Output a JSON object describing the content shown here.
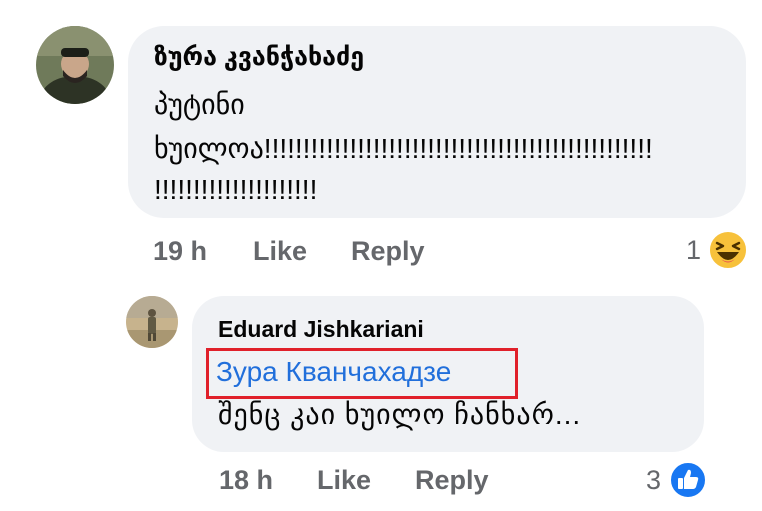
{
  "comment": {
    "author": "ზურა კვანჭახაძე",
    "lines": [
      "პუტინი",
      "ხუილოა!!!!!!!!!!!!!!!!!!!!!!!!!!!!!!!!!!!!!!!!!!!!!!!!!!",
      "!!!!!!!!!!!!!!!!!!!!!"
    ],
    "time": "19 h",
    "like_label": "Like",
    "reply_label": "Reply",
    "reaction_count": "1",
    "reaction_icon": "laughing-emoji-icon"
  },
  "reply": {
    "author": "Eduard Jishkariani",
    "mention": "Зура Кванчахадзе",
    "text": "შენც კაი ხუილო ჩანხარ...",
    "time": "18 h",
    "like_label": "Like",
    "reply_label": "Reply",
    "reaction_count": "3",
    "reaction_icon": "thumbs-up-icon"
  },
  "colors": {
    "bubble": "#f0f2f5",
    "meta_text": "#65676b",
    "mention_link": "#216fdb",
    "highlight_box": "#e0202a",
    "like_blue": "#1877f2",
    "emoji_yellow": "#f7c13b"
  }
}
